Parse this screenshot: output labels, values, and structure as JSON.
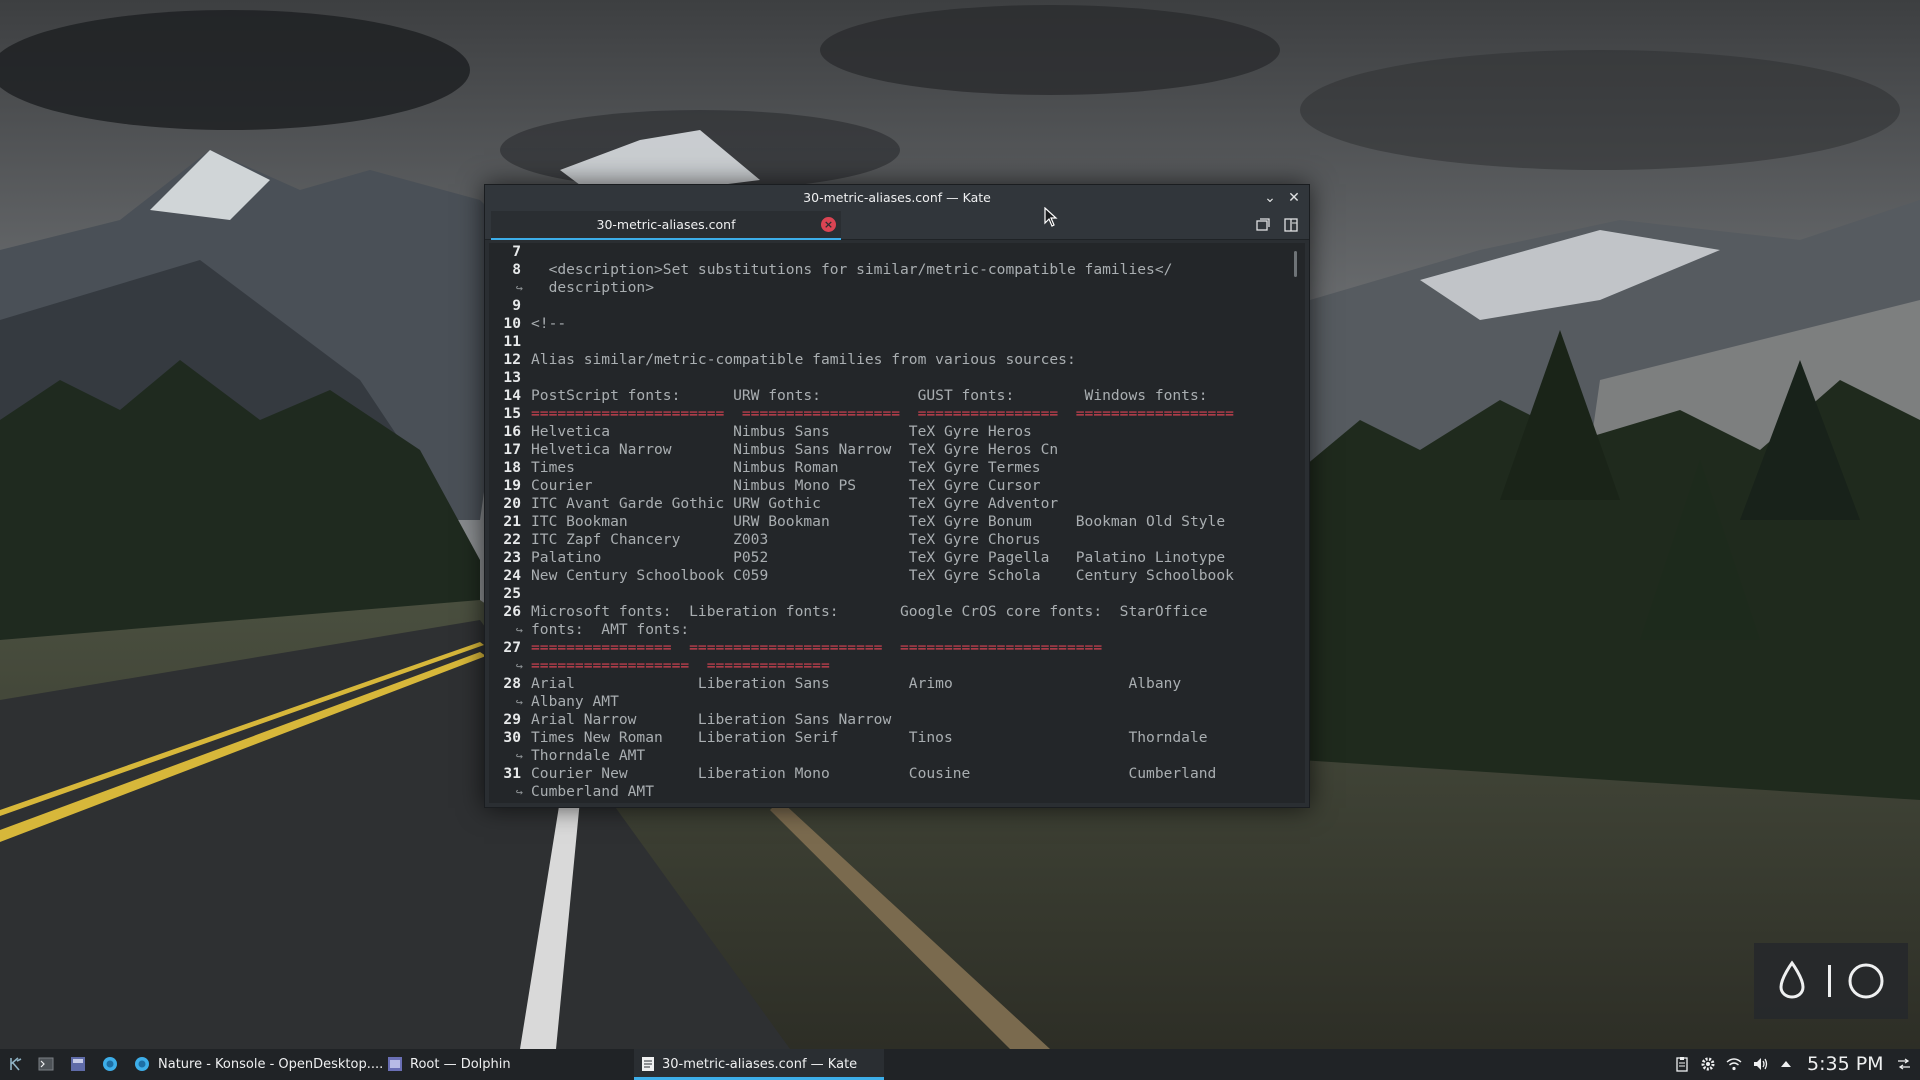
{
  "window": {
    "title": "30-metric-aliases.conf — Kate",
    "tab_label": "30-metric-aliases.conf",
    "minimize_icon": "chevron-down-icon",
    "close_icon": "close-icon"
  },
  "editor": {
    "lines": [
      {
        "num": "7",
        "text": ""
      },
      {
        "num": "8",
        "text": "  <description>Set substitutions for similar/metric-compatible families</"
      },
      {
        "num": "",
        "wrap": true,
        "text": "  description>"
      },
      {
        "num": "9",
        "text": ""
      },
      {
        "num": "10",
        "text": "<!--"
      },
      {
        "num": "11",
        "text": ""
      },
      {
        "num": "12",
        "text": "Alias similar/metric-compatible families from various sources:"
      },
      {
        "num": "13",
        "text": ""
      },
      {
        "num": "14",
        "text": "PostScript fonts:      URW fonts:           GUST fonts:        Windows fonts:"
      },
      {
        "num": "15",
        "text": "======================  ==================  ================  ==================",
        "style": "eq"
      },
      {
        "num": "16",
        "text": "Helvetica              Nimbus Sans         TeX Gyre Heros"
      },
      {
        "num": "17",
        "text": "Helvetica Narrow       Nimbus Sans Narrow  TeX Gyre Heros Cn"
      },
      {
        "num": "18",
        "text": "Times                  Nimbus Roman        TeX Gyre Termes"
      },
      {
        "num": "19",
        "text": "Courier                Nimbus Mono PS      TeX Gyre Cursor"
      },
      {
        "num": "20",
        "text": "ITC Avant Garde Gothic URW Gothic          TeX Gyre Adventor"
      },
      {
        "num": "21",
        "text": "ITC Bookman            URW Bookman         TeX Gyre Bonum     Bookman Old Style"
      },
      {
        "num": "22",
        "text": "ITC Zapf Chancery      Z003                TeX Gyre Chorus"
      },
      {
        "num": "23",
        "text": "Palatino               P052                TeX Gyre Pagella   Palatino Linotype"
      },
      {
        "num": "24",
        "text": "New Century Schoolbook C059                TeX Gyre Schola    Century Schoolbook"
      },
      {
        "num": "25",
        "text": ""
      },
      {
        "num": "26",
        "text": "Microsoft fonts:  Liberation fonts:       Google CrOS core fonts:  StarOffice"
      },
      {
        "num": "",
        "wrap": true,
        "text": "fonts:  AMT fonts:"
      },
      {
        "num": "27",
        "text": "================  ======================  =======================",
        "style": "eq"
      },
      {
        "num": "",
        "wrap": true,
        "text": "==================  ==============",
        "style": "eq"
      },
      {
        "num": "28",
        "text": "Arial              Liberation Sans         Arimo                    Albany"
      },
      {
        "num": "",
        "wrap": true,
        "text": "Albany AMT"
      },
      {
        "num": "29",
        "text": "Arial Narrow       Liberation Sans Narrow"
      },
      {
        "num": "30",
        "text": "Times New Roman    Liberation Serif        Tinos                    Thorndale"
      },
      {
        "num": "",
        "wrap": true,
        "text": "Thorndale AMT"
      },
      {
        "num": "31",
        "text": "Courier New        Liberation Mono         Cousine                  Cumberland"
      },
      {
        "num": "",
        "wrap": true,
        "text": "Cumberland AMT"
      }
    ]
  },
  "taskbar": {
    "launcher_icon": "kde-launcher-icon",
    "quick_launch": [
      "terminal-icon",
      "file-manager-icon",
      "browser-icon"
    ],
    "tasks": [
      {
        "label": "Nature - Konsole - OpenDesktop....",
        "icon": "browser-icon",
        "active": false
      },
      {
        "label": "Root — Dolphin",
        "icon": "dolphin-icon",
        "active": false
      },
      {
        "label": "30-metric-aliases.conf  — Kate",
        "icon": "kate-icon",
        "active": true
      }
    ],
    "tray_icons": [
      "clipboard-icon",
      "settings-icon",
      "wifi-icon",
      "volume-icon",
      "tray-expand-icon"
    ],
    "clock": "5:35 PM",
    "accent_color": "#3daee9"
  }
}
